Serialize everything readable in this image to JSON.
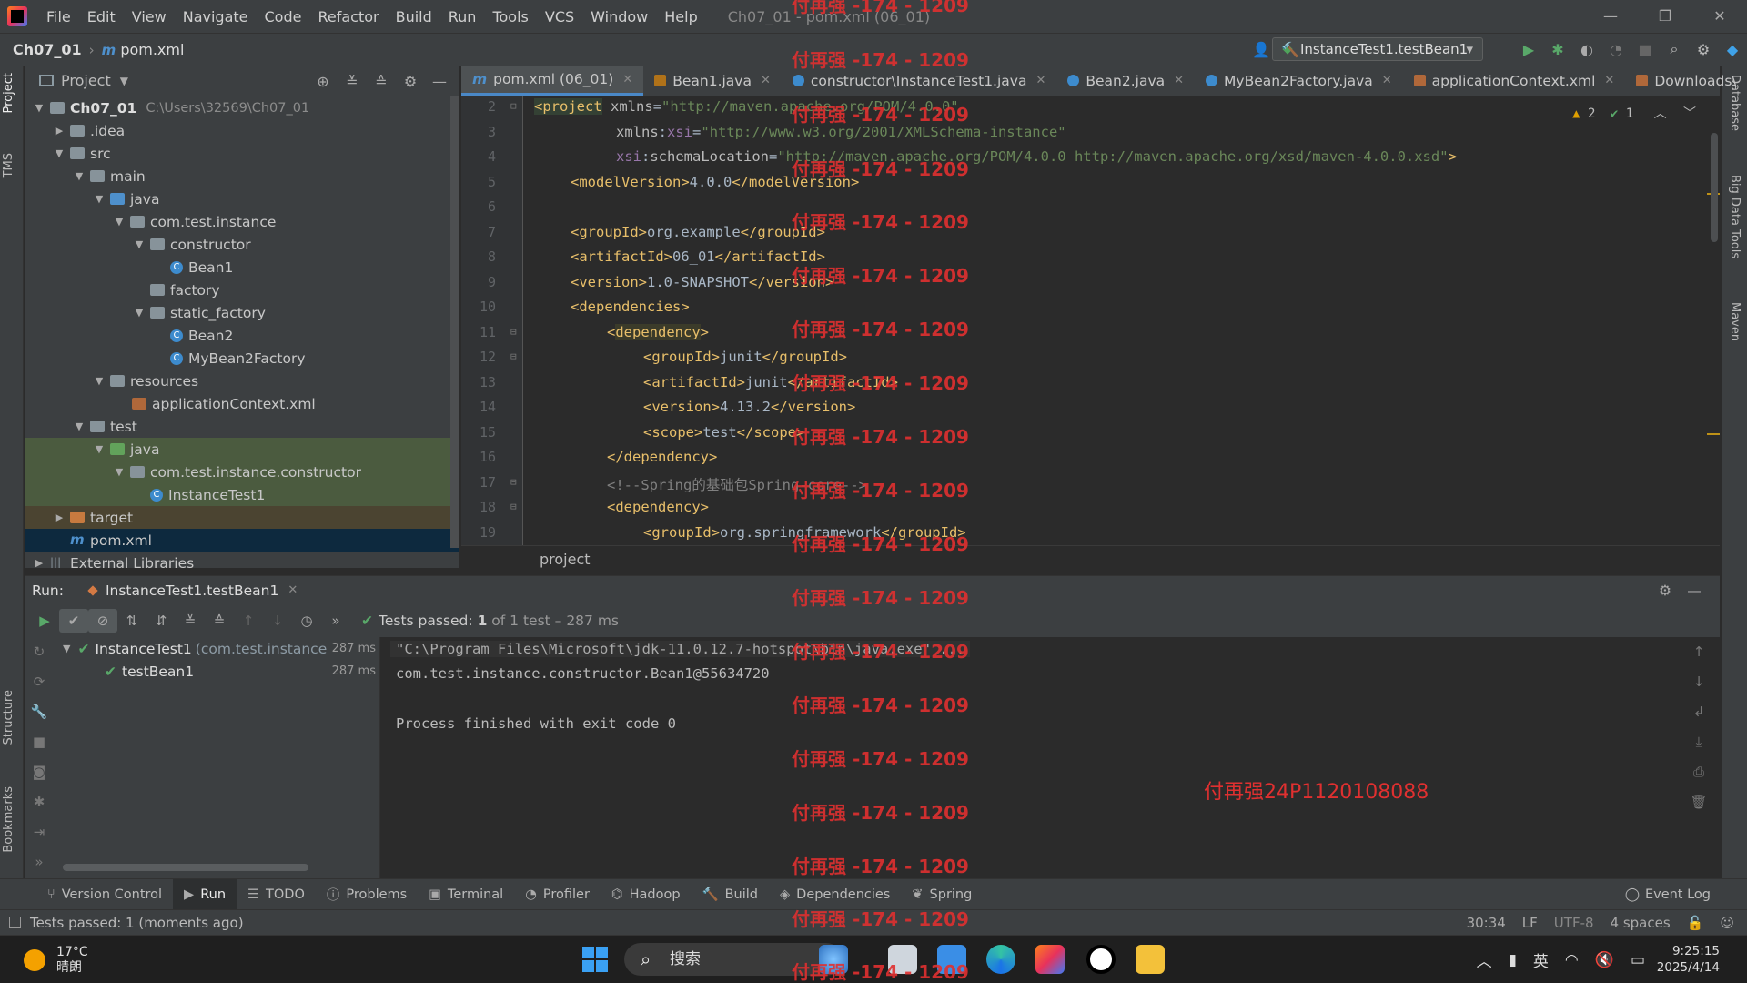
{
  "window": {
    "title": "Ch07_01 - pom.xml (06_01)",
    "controls": [
      "—",
      "❐",
      "✕"
    ]
  },
  "menu": [
    "File",
    "Edit",
    "View",
    "Navigate",
    "Code",
    "Refactor",
    "Build",
    "Run",
    "Tools",
    "VCS",
    "Window",
    "Help"
  ],
  "breadcrumb": {
    "project": "Ch07_01",
    "file": "pom.xml"
  },
  "run_config": "InstanceTest1.testBean1",
  "project_panel": {
    "title": "Project",
    "tree": [
      {
        "label": "Ch07_01",
        "path": "C:\\Users\\32569\\Ch07_01"
      },
      {
        "label": ".idea"
      },
      {
        "label": "src"
      },
      {
        "label": "main"
      },
      {
        "label": "java"
      },
      {
        "label": "com.test.instance"
      },
      {
        "label": "constructor"
      },
      {
        "label": "Bean1"
      },
      {
        "label": "factory"
      },
      {
        "label": "static_factory"
      },
      {
        "label": "Bean2"
      },
      {
        "label": "MyBean2Factory"
      },
      {
        "label": "resources"
      },
      {
        "label": "applicationContext.xml"
      },
      {
        "label": "test"
      },
      {
        "label": "java"
      },
      {
        "label": "com.test.instance.constructor"
      },
      {
        "label": "InstanceTest1"
      },
      {
        "label": "target"
      },
      {
        "label": "pom.xml"
      },
      {
        "label": "External Libraries"
      }
    ]
  },
  "editor_tabs": [
    {
      "label": "pom.xml (06_01)"
    },
    {
      "label": "Bean1.java"
    },
    {
      "label": "constructor\\InstanceTest1.java"
    },
    {
      "label": "Bean2.java"
    },
    {
      "label": "MyBean2Factory.java"
    },
    {
      "label": "applicationContext.xml"
    },
    {
      "label": "Downloads\\"
    }
  ],
  "editor": {
    "line_numbers": [
      "2",
      "3",
      "4",
      "5",
      "6",
      "7",
      "8",
      "9",
      "10",
      "11",
      "12",
      "13",
      "14",
      "15",
      "16",
      "17",
      "18",
      "19"
    ],
    "inspection_warnings": "2",
    "inspection_ok": "1",
    "code_breadcrumb": "project"
  },
  "code": {
    "l2": {
      "tag": "project",
      "a1": "xmlns",
      "v1": "\"http://maven.apache.org/POM/4.0.0\""
    },
    "l3": {
      "ns": "xmlns",
      "a": "xsi",
      "v": "\"http://www.w3.org/2001/XMLSchema-instance\""
    },
    "l4": {
      "ns": "xsi",
      "a": "schemaLocation",
      "v": "\"http://maven.apache.org/POM/4.0.0 http://maven.apache.org/xsd/maven-4.0.0.xsd\""
    },
    "l5": {
      "open": "<modelVersion>",
      "text": "4.0.0",
      "close": "</modelVersion>"
    },
    "l7": {
      "open": "<groupId>",
      "text": "org.example",
      "close": "</groupId>"
    },
    "l8": {
      "open": "<artifactId>",
      "text": "06_01",
      "close": "</artifactId>"
    },
    "l9": {
      "open": "<version>",
      "text": "1.0-SNAPSHOT",
      "close": "</version>"
    },
    "l10": {
      "open": "<dependencies>"
    },
    "l11": {
      "tag": "dependency"
    },
    "l12": {
      "open": "<groupId>",
      "text": "junit",
      "close": "</groupId>"
    },
    "l13": {
      "open": "<artifactId>",
      "text": "junit",
      "close": "</artifactId>"
    },
    "l14": {
      "open": "<version>",
      "text": "4.13.2",
      "close": "</version>"
    },
    "l15": {
      "open": "<scope>",
      "text": "test",
      "close": "</scope>"
    },
    "l16": {
      "close": "</dependency>"
    },
    "l17": {
      "comment": "<!--Spring的基础包Spring-core-->"
    },
    "l18": {
      "open": "<dependency>"
    },
    "l19": {
      "open": "<groupId>",
      "text": "org.springframework",
      "close": "</groupId>"
    }
  },
  "run_panel": {
    "label": "Run:",
    "tab": "InstanceTest1.testBean1",
    "status": {
      "prefix": "Tests passed:",
      "count": "1",
      "detail": "of 1 test – 287 ms"
    },
    "tests": [
      {
        "name": "InstanceTest1",
        "pkg": "(com.test.instance.c",
        "time": "287 ms"
      },
      {
        "name": "testBean1",
        "time": "287 ms"
      }
    ],
    "console": [
      "\"C:\\Program Files\\Microsoft\\jdk-11.0.12.7-hotspot\\bin\\java.exe\" ...",
      "com.test.instance.constructor.Bean1@55634720",
      "",
      "Process finished with exit code 0"
    ]
  },
  "tool_windows": [
    "Version Control",
    "Run",
    "TODO",
    "Problems",
    "Terminal",
    "Profiler",
    "Hadoop",
    "Build",
    "Dependencies",
    "Spring"
  ],
  "event_log": "Event Log",
  "side_labels": {
    "left": [
      "Project",
      "TMS",
      "Structure",
      "Bookmarks"
    ],
    "right": [
      "Database",
      "Big Data Tools",
      "Maven"
    ]
  },
  "status_bar": {
    "message": "Tests passed: 1 (moments ago)",
    "position": "30:34",
    "line_sep": "LF",
    "encoding": "UTF-8",
    "indent": "4 spaces"
  },
  "taskbar": {
    "temp": "17°C",
    "weather": "晴朗",
    "search": "搜索",
    "ime": "英",
    "time": "9:25:15",
    "date": "2025/4/14"
  },
  "watermark": {
    "repeat": "付再强 -174 - 1209",
    "id": "付再强24P1120108088"
  }
}
